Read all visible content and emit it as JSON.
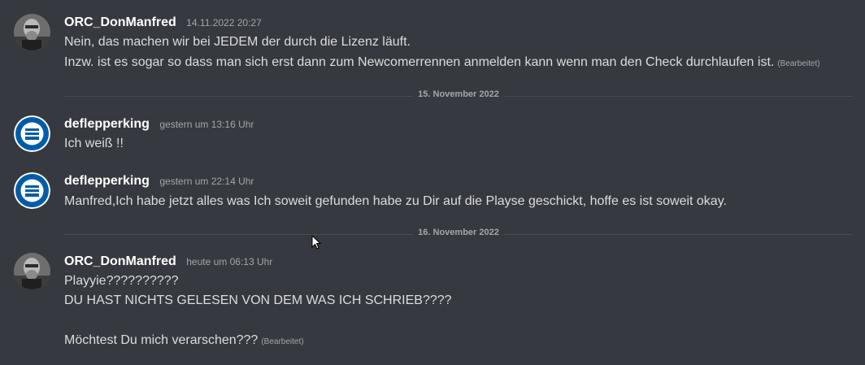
{
  "messages": [
    {
      "author": "ORC_DonManfred",
      "timestamp": "14.11.2022 20:27",
      "avatar": "orc-donmanfred-avatar",
      "lines": [
        "Nein, das machen wir bei JEDEM der durch die Lizenz läuft.",
        "Inzw. ist es sogar so dass man sich erst dann zum Newcomerrennen anmelden kann wenn man den Check durchlaufen ist."
      ],
      "edited_label": "(Bearbeitet)"
    },
    {
      "author": "deflepperking",
      "timestamp": "gestern um 13:16 Uhr",
      "avatar": "hertha-bsc-avatar",
      "lines": [
        "Ich weiß !!"
      ]
    },
    {
      "author": "deflepperking",
      "timestamp": "gestern um 22:14 Uhr",
      "avatar": "hertha-bsc-avatar",
      "lines": [
        "Manfred,Ich habe jetzt alles was Ich soweit gefunden habe zu Dir auf die Playse geschickt, hoffe es ist soweit okay."
      ]
    },
    {
      "author": "ORC_DonManfred",
      "timestamp": "heute um 06:13 Uhr",
      "avatar": "orc-donmanfred-avatar",
      "lines": [
        "Playyie??????????",
        "DU HAST NICHTS GELESEN VON DEM WAS ICH SCHRIEB????",
        "",
        "Möchtest Du mich verarschen???"
      ],
      "edited_label": "(Bearbeitet)"
    }
  ],
  "dividers": [
    "15. November 2022",
    "16. November 2022"
  ],
  "colors": {
    "background": "#36393f",
    "username": "#ffffff",
    "text": "#dcddde",
    "muted": "#a3a6aa",
    "hertha_blue": "#005ca9"
  }
}
